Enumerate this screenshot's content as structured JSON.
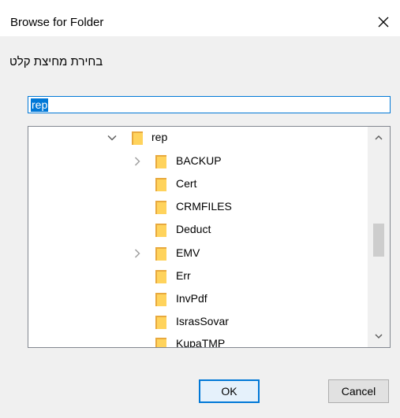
{
  "window": {
    "title": "Browse for Folder"
  },
  "prompt": "בחירת מחיצת קלט",
  "path_input": {
    "value": "rep"
  },
  "tree": {
    "root": {
      "label": "rep",
      "expanded": true
    },
    "children": [
      {
        "label": "BACKUP",
        "has_children": true
      },
      {
        "label": "Cert",
        "has_children": false
      },
      {
        "label": "CRMFILES",
        "has_children": false
      },
      {
        "label": "Deduct",
        "has_children": false
      },
      {
        "label": "EMV",
        "has_children": true
      },
      {
        "label": "Err",
        "has_children": false
      },
      {
        "label": "InvPdf",
        "has_children": false
      },
      {
        "label": "IsrasSovar",
        "has_children": false
      },
      {
        "label": "KupaTMP",
        "has_children": false
      }
    ]
  },
  "buttons": {
    "ok": "OK",
    "cancel": "Cancel"
  },
  "colors": {
    "accent": "#0078d7",
    "folder_body": "#ffd35c",
    "folder_back": "#e8a93e",
    "arrow": "#606060"
  }
}
